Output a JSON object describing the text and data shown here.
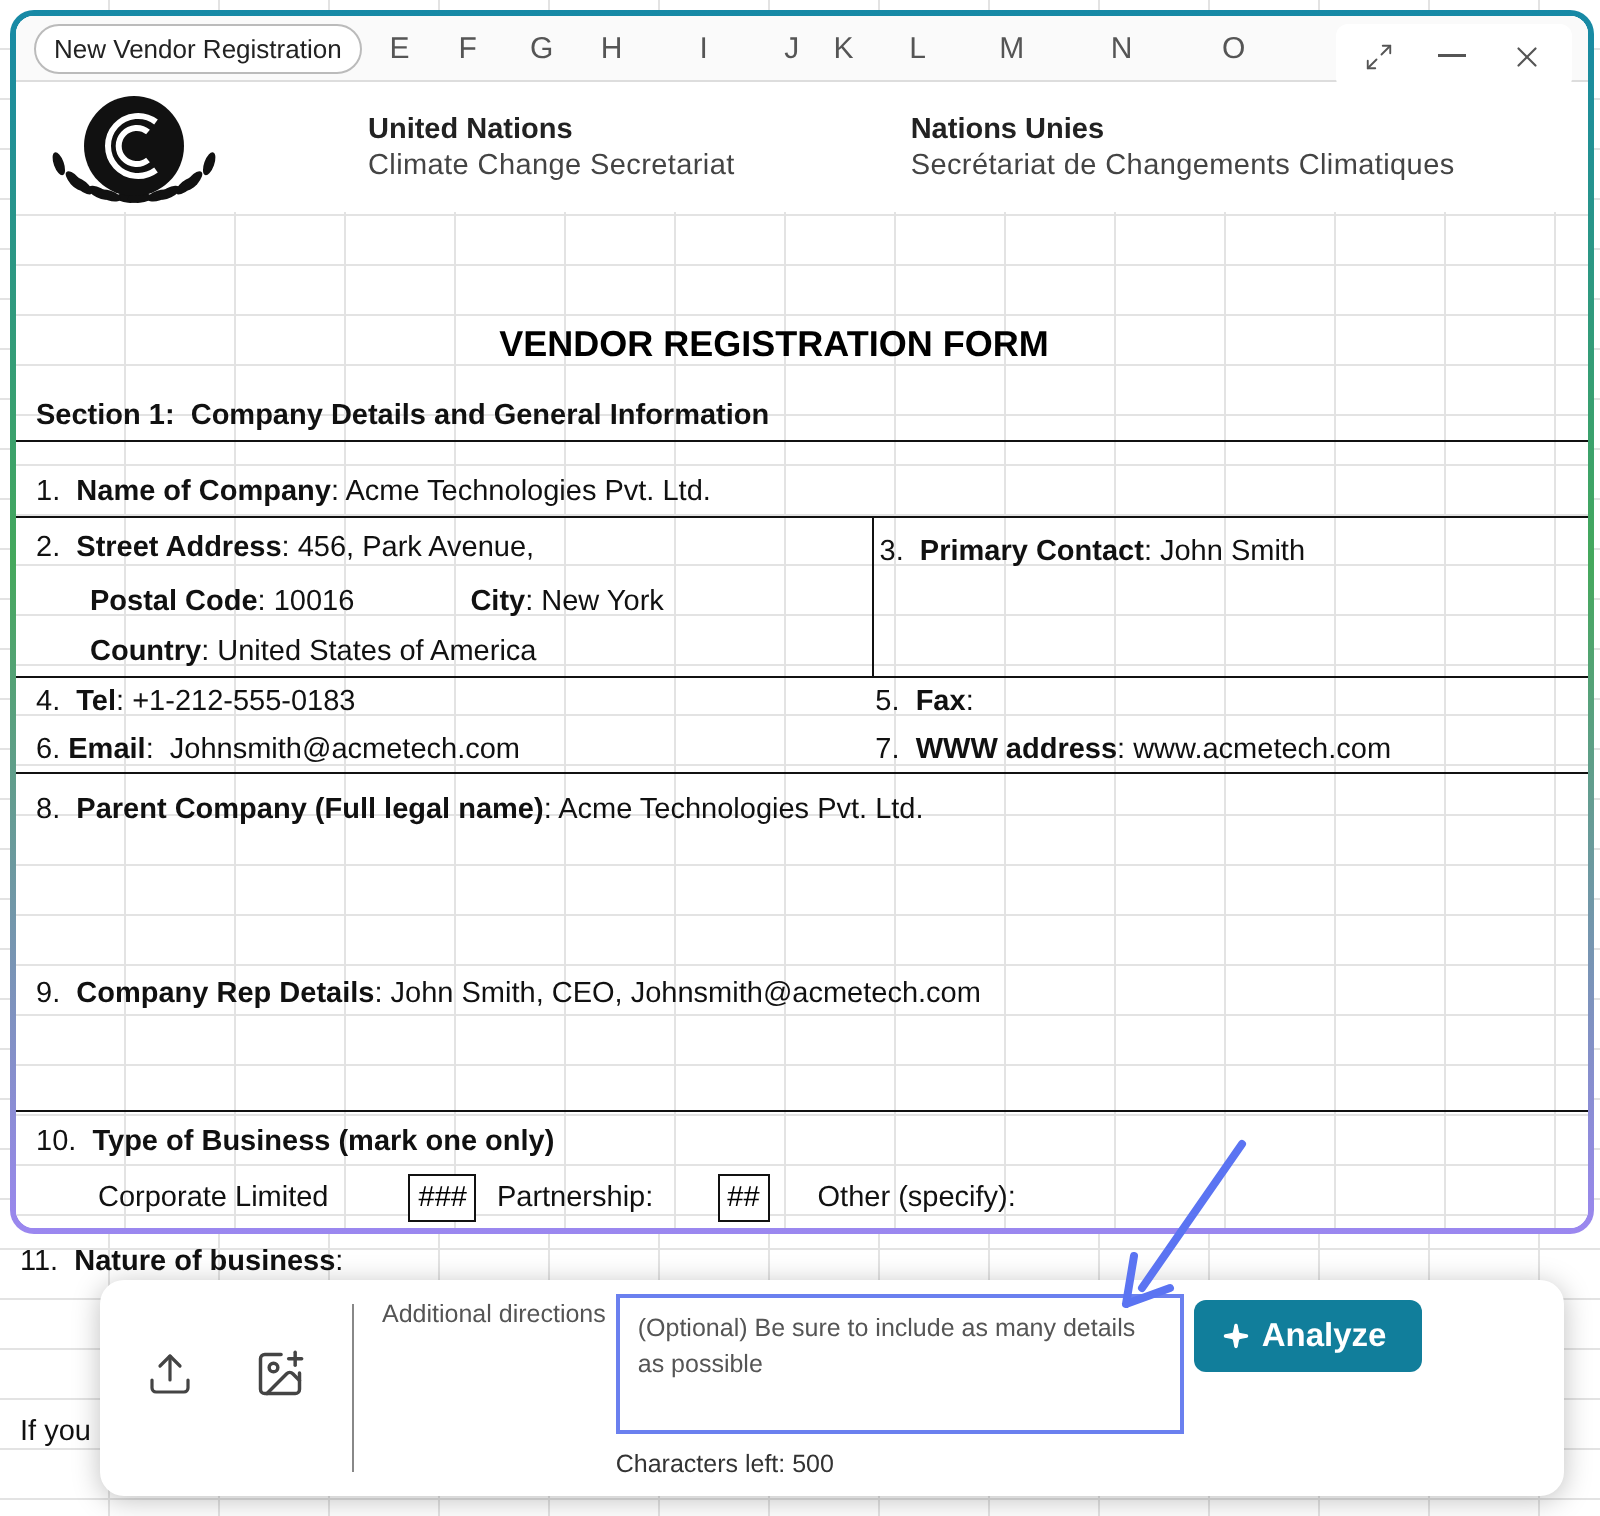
{
  "badge": "New Vendor Registration",
  "column_headers": [
    "E",
    "F",
    "G",
    "H",
    "I",
    "J",
    "K",
    "L",
    "M",
    "N",
    "O"
  ],
  "letterhead": {
    "left": {
      "title": "United Nations",
      "subtitle": "Climate Change Secretariat"
    },
    "right": {
      "title": "Nations Unies",
      "subtitle": "Secrétariat de Changements Climatiques"
    }
  },
  "form": {
    "title": "VENDOR REGISTRATION FORM",
    "section": "Section 1:  Company Details and General Information",
    "name_of_company": "1.  **Name of Company**: Acme Technologies Pvt. Ltd.",
    "street_address": "2.  **Street Address**: 456, Park Avenue,",
    "postal_code": "**Postal Code**: 10016",
    "city": "**City**: New York",
    "country": "**Country**: United States of America",
    "primary_contact": "3.  **Primary Contact**: John Smith",
    "tel": "4.  **Tel**: +1-212-555-0183",
    "fax": "5.  **Fax**:",
    "email": "6. **Email**:  Johnsmith@acmetech.com",
    "www": "7.  **WWW address**: www.acmetech.com",
    "parent_company": "8.  **Parent Company (Full legal name)**: Acme Technologies Pvt. Ltd.",
    "rep_details": "9.  **Company Rep Details**: John Smith, CEO, Johnsmith@acmetech.com",
    "type_of_business": {
      "heading": "10.  **Type of Business (mark one only)**",
      "options": [
        {
          "label": "Corporate Limited",
          "mark": "###"
        },
        {
          "label": "Partnership:",
          "mark": "##"
        },
        {
          "label": "Other (specify):"
        }
      ]
    }
  },
  "below_sheet": [
    "11.  **Nature of business**:",
    "If you"
  ],
  "panel": {
    "directions_label": "Additional directions",
    "directions_placeholder": "(Optional) Be sure to include as many details as possible",
    "chars_left": "Characters left: 500",
    "analyze": "Analyze"
  }
}
